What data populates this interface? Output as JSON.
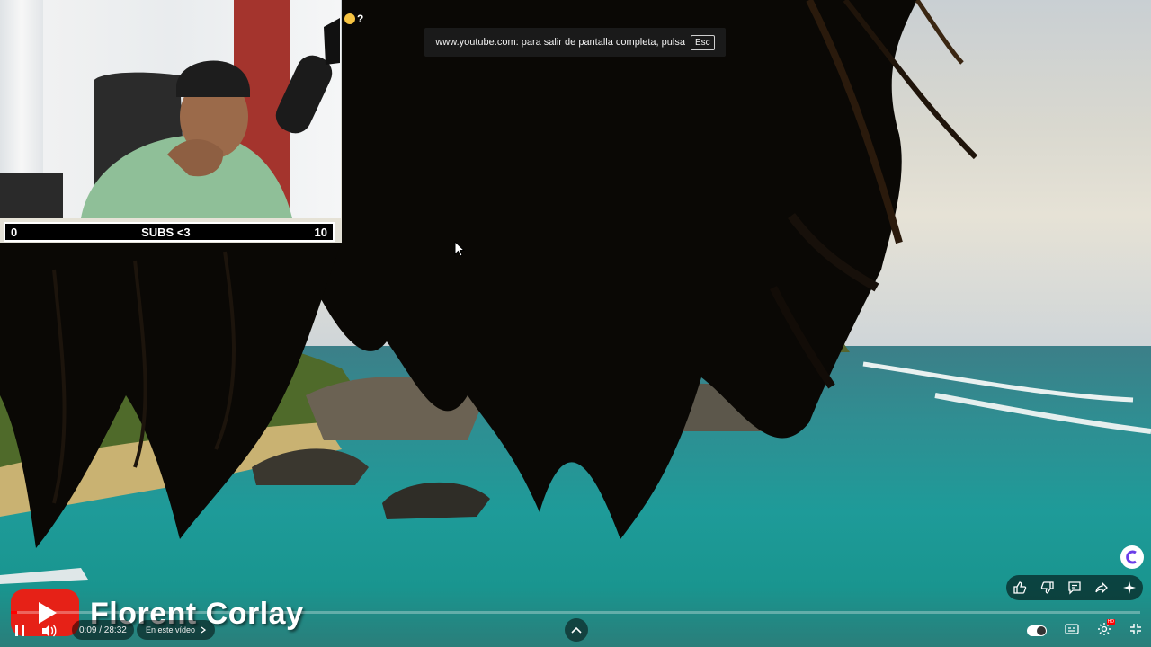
{
  "overlay": {
    "scoreboard": {
      "left_score": "0",
      "title": "SUBS <3",
      "right_score": "10"
    },
    "emoji_status": {
      "icon": "grinning-face-icon",
      "text": "?"
    }
  },
  "notice": {
    "text": "www.youtube.com: para salir de pantalla completa, pulsa",
    "key": "Esc"
  },
  "video": {
    "watermark": "Florent Corlay",
    "time_current": "0:09",
    "time_total": "28:32",
    "time_display": "0:09 / 28:32",
    "chapter_label": "En este vídeo",
    "progress": 0.0053
  },
  "actions": [
    "like-icon",
    "dislike-icon",
    "comment-icon",
    "share-icon",
    "sparkle-icon"
  ],
  "colors": {
    "accent": "#ff0000",
    "youtube_red": "#e62117"
  }
}
